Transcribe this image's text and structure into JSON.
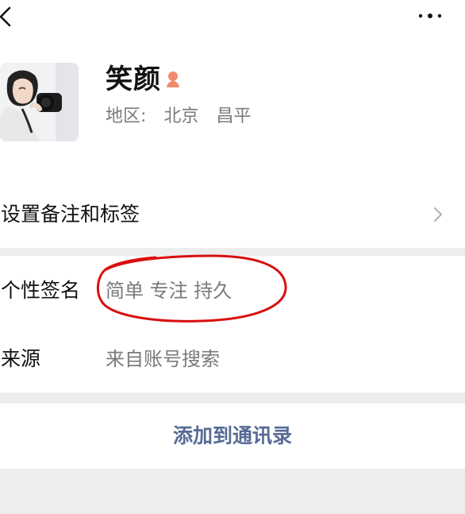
{
  "nav": {
    "back_icon": "chevron-left-icon",
    "more_icon": "more-dots-icon"
  },
  "profile": {
    "name": "笑颜",
    "gender_icon": "female-user-icon",
    "gender_color": "#f08a6b",
    "region_label": "地区:",
    "region_city": "北京",
    "region_district": "昌平"
  },
  "rows": {
    "remark_label": "设置备注和标签",
    "signature_label": "个性签名",
    "signature_value": "简单 专注 持久",
    "source_label": "来源",
    "source_value": "来自账号搜索"
  },
  "action": {
    "add_contact": "添加到通讯录",
    "accent": "#576b95"
  },
  "annotation": {
    "circle_color": "#d90f0f"
  }
}
